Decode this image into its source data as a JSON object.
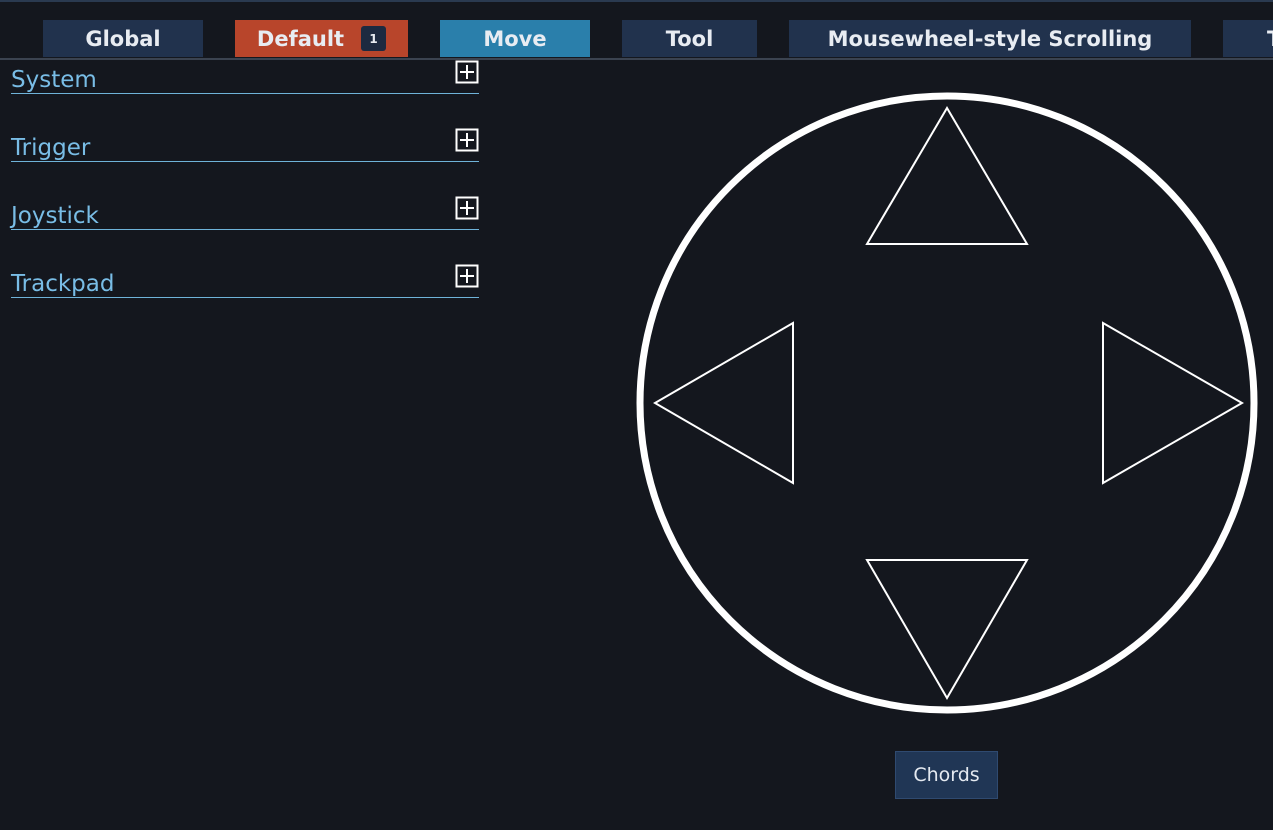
{
  "tabs": [
    {
      "label": "Global"
    },
    {
      "label": "Default",
      "badge": "1"
    },
    {
      "label": "Move"
    },
    {
      "label": "Tool"
    },
    {
      "label": "Mousewheel-style Scrolling"
    },
    {
      "label": "T"
    }
  ],
  "sections": [
    {
      "label": "System",
      "icon": "plus-square-icon"
    },
    {
      "label": "Trigger",
      "icon": "plus-square-icon"
    },
    {
      "label": "Joystick",
      "icon": "plus-square-icon"
    },
    {
      "label": "Trackpad",
      "icon": "plus-square-icon"
    }
  ],
  "dpad": {
    "directions": [
      "up",
      "left",
      "right",
      "down"
    ]
  },
  "chords_button": {
    "label": "Chords"
  },
  "colors": {
    "background": "#14171e",
    "tab_inactive": "#21324d",
    "tab_default": "#b8452b",
    "tab_move": "#2a7fab",
    "section_text": "#79bde6",
    "outline": "#ffffff"
  }
}
